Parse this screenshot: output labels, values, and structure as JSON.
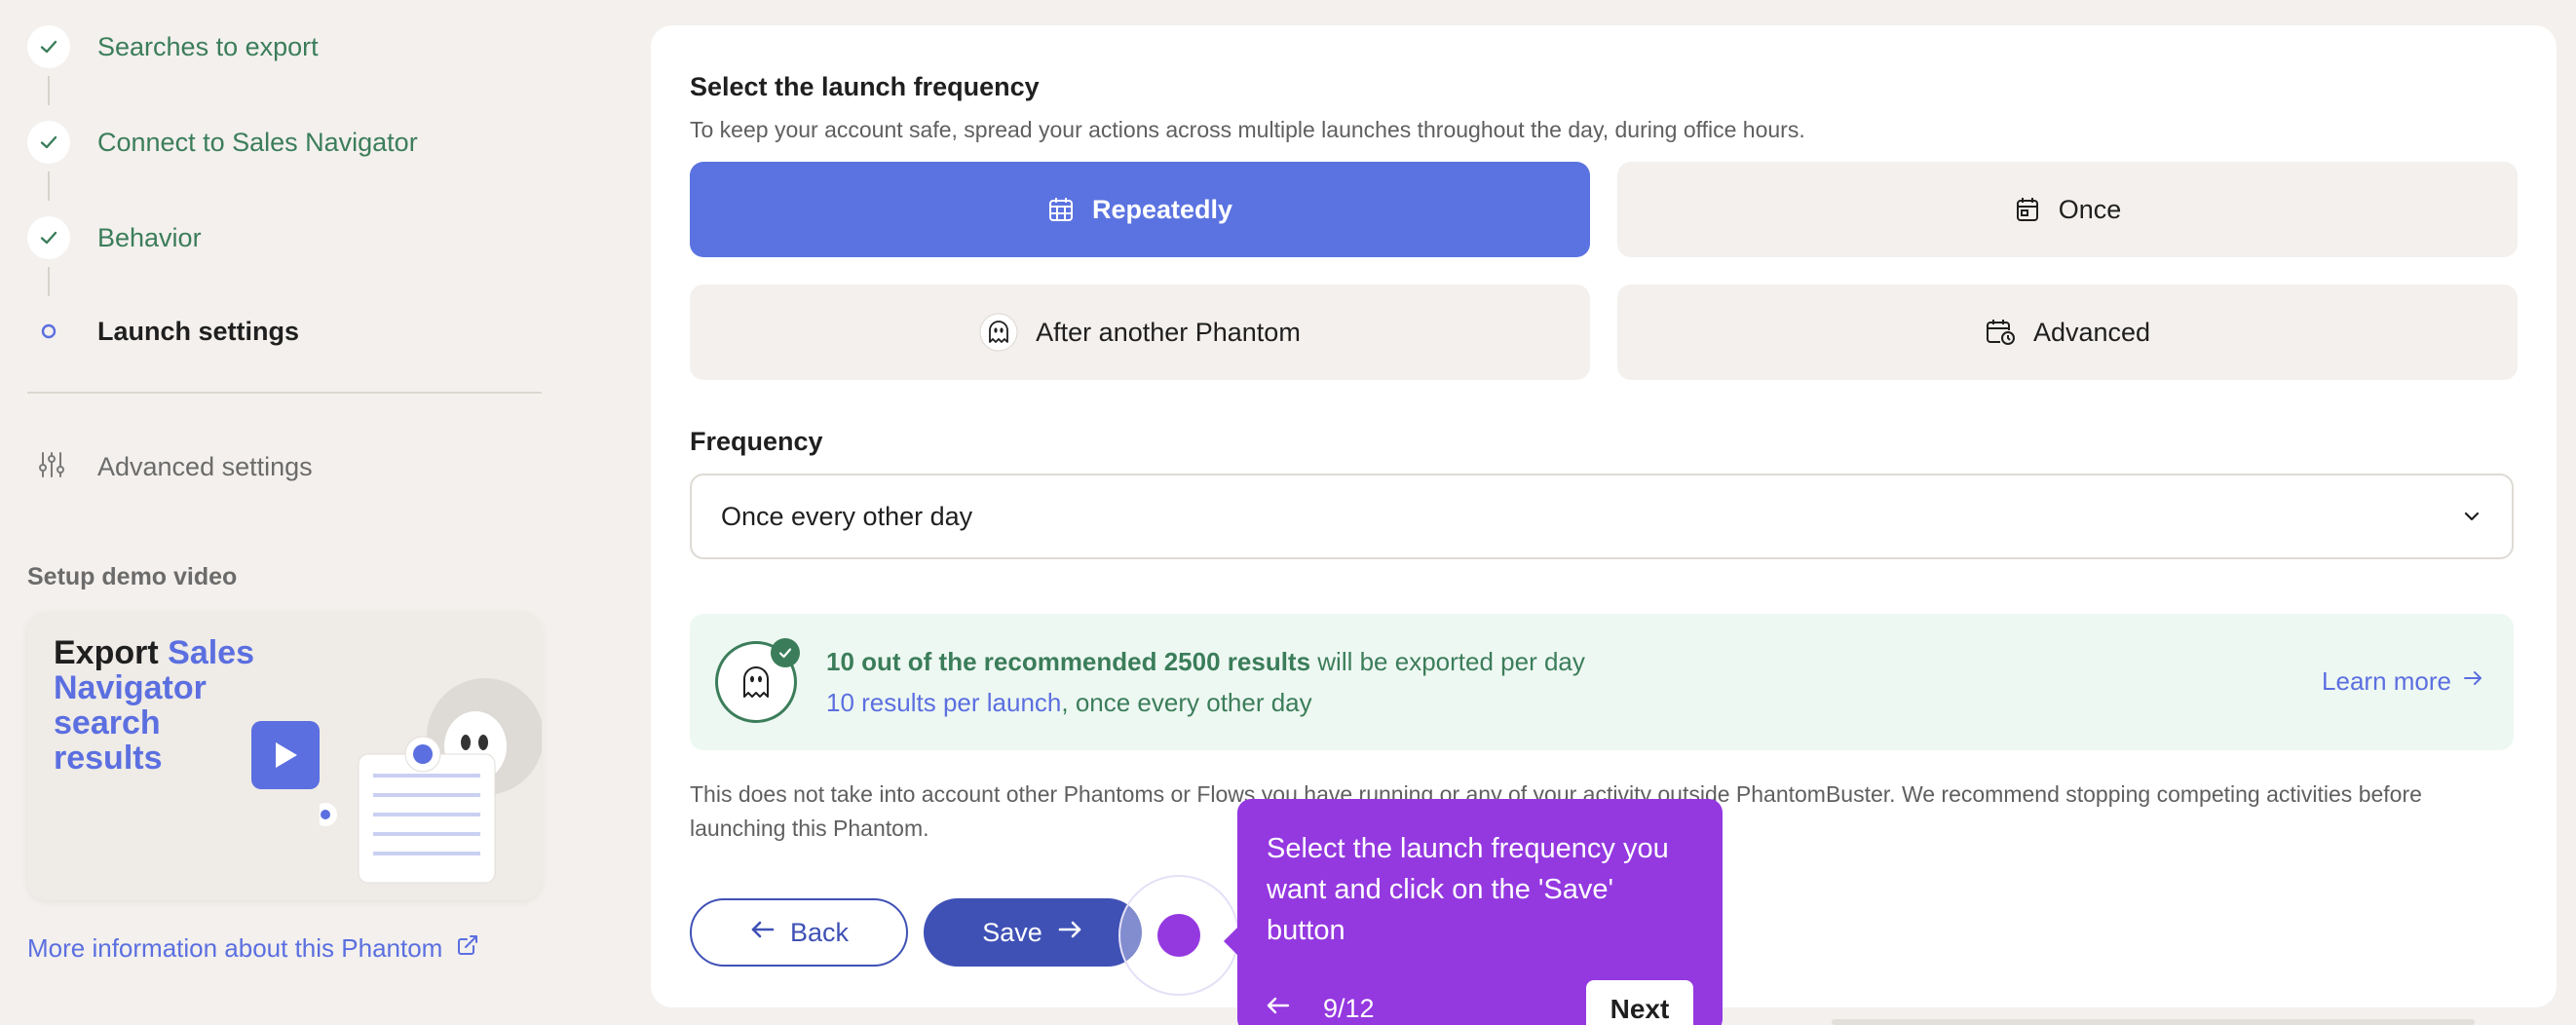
{
  "sidebar": {
    "steps": [
      {
        "label": "Searches to export",
        "state": "done"
      },
      {
        "label": "Connect to Sales Navigator",
        "state": "done"
      },
      {
        "label": "Behavior",
        "state": "done"
      },
      {
        "label": "Launch settings",
        "state": "current"
      }
    ],
    "advanced_settings_label": "Advanced settings",
    "demo_video_title": "Setup demo video",
    "video_card": {
      "title_dark": "Export",
      "title_accent_1": "Sales",
      "title_accent_2": "Navigator search results"
    },
    "more_info_label": "More information about this Phantom"
  },
  "main": {
    "title": "Select the launch frequency",
    "subtitle": "To keep your account safe, spread your actions across multiple launches throughout the day, during office hours.",
    "options": [
      {
        "label": "Repeatedly",
        "icon": "calendar-grid-icon",
        "selected": true
      },
      {
        "label": "Once",
        "icon": "calendar-icon",
        "selected": false
      },
      {
        "label": "After another Phantom",
        "icon": "ghost-icon",
        "selected": false
      },
      {
        "label": "Advanced",
        "icon": "calendar-clock-icon",
        "selected": false
      }
    ],
    "frequency_label": "Frequency",
    "frequency_value": "Once every other day",
    "info": {
      "bold": "10 out of the recommended 2500 results",
      "rest": " will be exported per day",
      "per_launch": "10 results per launch",
      "schedule": ", once every other day",
      "learn_more": "Learn more"
    },
    "disclaimer": "This does not take into account other Phantoms or Flows you have running or any of your activity outside PhantomBuster. We recommend stopping competing activities before launching this Phantom.",
    "back_label": "Back",
    "save_label": "Save"
  },
  "tour": {
    "message": "Select the launch frequency you want and click on the 'Save' button",
    "counter": "9/12",
    "next_label": "Next"
  },
  "colors": {
    "accent": "#5b73e1",
    "primary_button": "#3f51b5",
    "success": "#3b7d5a",
    "tour": "#9438e0"
  }
}
